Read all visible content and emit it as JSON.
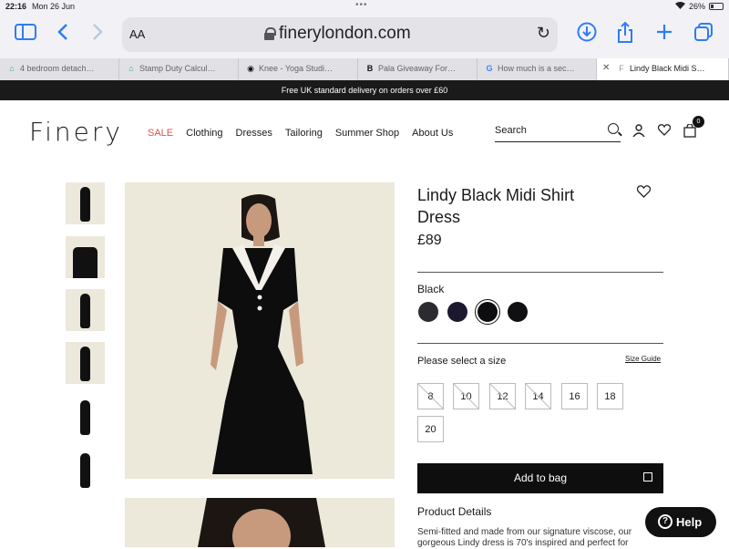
{
  "status": {
    "time": "22:16",
    "date": "Mon 26 Jun",
    "battery": "26%"
  },
  "browser": {
    "text_size_label": "AA",
    "url": "finerylondon.com",
    "tabs": [
      {
        "title": "4 bedroom detach…"
      },
      {
        "title": "Stamp Duty Calcul…"
      },
      {
        "title": "Knee - Yoga Studi…"
      },
      {
        "title": "Pala Giveaway For…"
      },
      {
        "title": "How much is a sec…"
      },
      {
        "title": "Lindy Black Midi S…"
      }
    ]
  },
  "promo": {
    "text": "Free UK standard delivery on orders over £60"
  },
  "site": {
    "logo": "Finery",
    "nav": [
      "SALE",
      "Clothing",
      "Dresses",
      "Tailoring",
      "Summer Shop",
      "About Us"
    ],
    "search_label": "Search",
    "bag_count": "0"
  },
  "product": {
    "title": "Lindy Black Midi Shirt Dress",
    "price": "£89",
    "color_label": "Black",
    "swatches": [
      "#2b2b30",
      "#1b1830",
      "#0d0d10",
      "#101012"
    ],
    "size_prompt": "Please select a size",
    "size_guide": "Size Guide",
    "sizes": [
      "8",
      "10",
      "12",
      "14",
      "16",
      "18",
      "20"
    ],
    "add_to_bag": "Add to bag",
    "details_heading": "Product Details",
    "description": "Semi-fitted and made from our signature viscose, our gorgeous Lindy dress is 70's inspired and perfect for"
  },
  "help": {
    "label": "Help"
  }
}
